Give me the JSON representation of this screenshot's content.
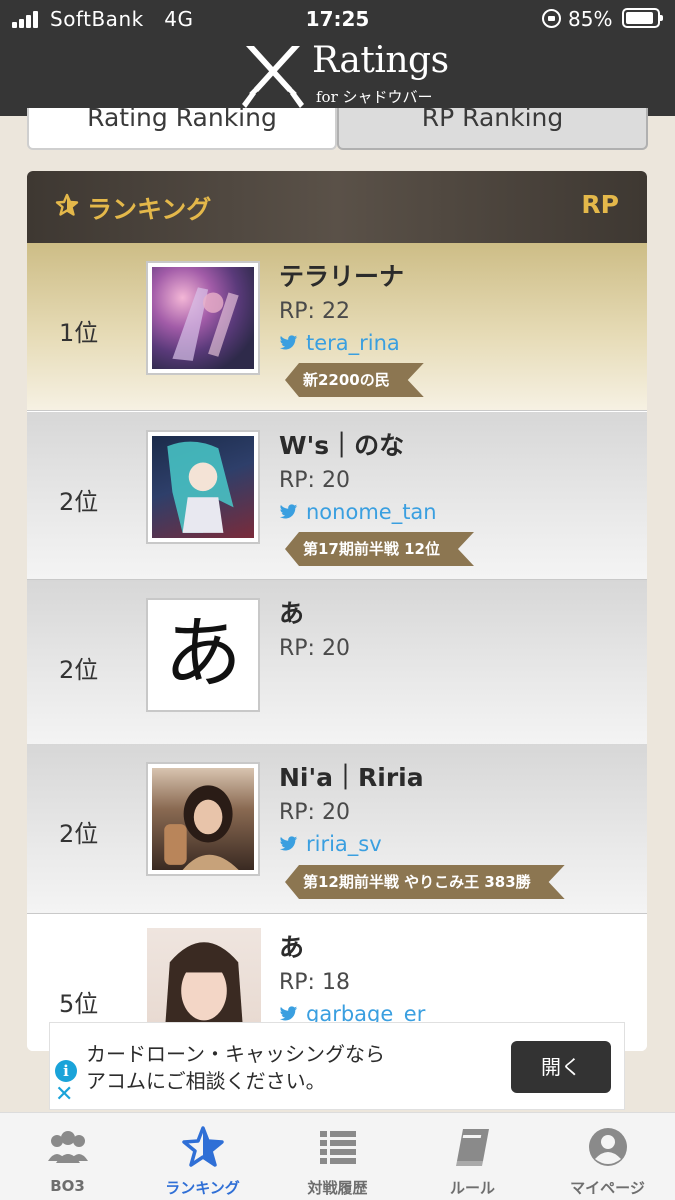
{
  "status_bar": {
    "carrier": "SoftBank",
    "network": "4G",
    "time": "17:25",
    "battery": "85%"
  },
  "header": {
    "logo_title": "Ratings",
    "logo_subtitle": "for シャドウバース",
    "logo_icon": "crossed-swords-icon"
  },
  "tabs": [
    {
      "label": "Rating Ranking",
      "selected": false
    },
    {
      "label": "RP Ranking",
      "selected": true
    }
  ],
  "ranking": {
    "title": "ランキング",
    "column_label": "RP",
    "accent_color": "#e4b84a",
    "rows": [
      {
        "rank": "1位",
        "name": "テラリーナ",
        "rp": "RP: 22",
        "twitter": "tera_rina",
        "badge": "新2200の民",
        "avatar": "anime-art"
      },
      {
        "rank": "2位",
        "name": "W's｜のな",
        "rp": "RP: 20",
        "twitter": "nonome_tan",
        "badge": "第17期前半戦 12位",
        "avatar": "miku-art"
      },
      {
        "rank": "2位",
        "name": "あ",
        "rp": "RP: 20",
        "twitter": "",
        "badge": "",
        "avatar": "hiragana-a",
        "avatar_char": "あ"
      },
      {
        "rank": "2位",
        "name": "Ni'a｜Riria",
        "rp": "RP: 20",
        "twitter": "riria_sv",
        "badge": "第12期前半戦 やりこみ王 383勝",
        "avatar": "photo"
      },
      {
        "rank": "5位",
        "name": "あ",
        "rp": "RP: 18",
        "twitter": "garbage_er",
        "badge": "",
        "avatar": "photo"
      }
    ]
  },
  "ad": {
    "line1": "カードローン・キャッシングなら",
    "line2": "アコムにご相談ください。",
    "button": "開く",
    "close": "✕"
  },
  "bottom_nav": [
    {
      "label": "BO3",
      "icon": "group-icon"
    },
    {
      "label": "ランキング",
      "icon": "star-icon",
      "active": true
    },
    {
      "label": "対戦履歴",
      "icon": "list-icon"
    },
    {
      "label": "ルール",
      "icon": "book-icon"
    },
    {
      "label": "マイページ",
      "icon": "user-icon"
    }
  ]
}
